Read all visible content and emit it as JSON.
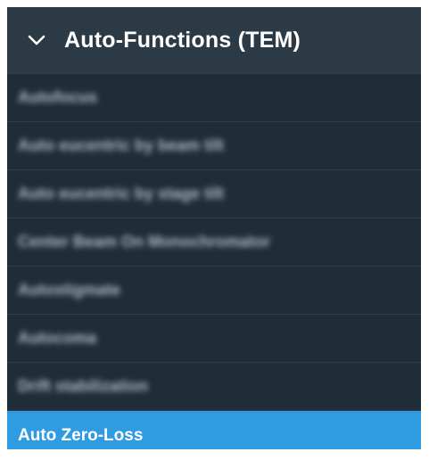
{
  "header": {
    "title": "Auto-Functions (TEM)",
    "icon": "chevron-down-icon"
  },
  "items": [
    {
      "label": "Autofocus",
      "blurred": true
    },
    {
      "label": "Auto eucentric by beam tilt",
      "blurred": true
    },
    {
      "label": "Auto eucentric by stage tilt",
      "blurred": true
    },
    {
      "label": "Center Beam On Monochromator",
      "blurred": true
    },
    {
      "label": "Autostigmate",
      "blurred": true
    },
    {
      "label": "Autocoma",
      "blurred": true
    },
    {
      "label": "Drift stabilization",
      "blurred": true
    },
    {
      "label": "Auto Zero-Loss",
      "blurred": false,
      "selected": true
    }
  ],
  "colors": {
    "panel_bg": "#1f2d38",
    "header_bg": "#2b3a45",
    "selected_bg": "#2f9be0",
    "text": "#ffffff"
  }
}
